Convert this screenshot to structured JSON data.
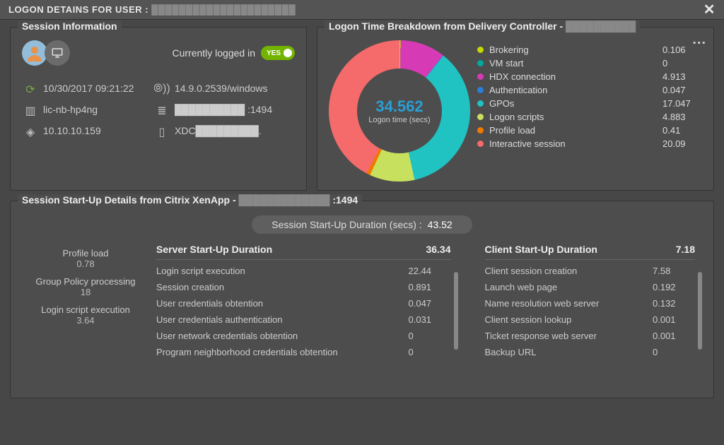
{
  "window": {
    "title_prefix": "LOGON DETAINS FOR USER :",
    "title_user": "█████████████████████"
  },
  "session_info": {
    "title": "Session Information",
    "logged_in_label": "Currently logged in",
    "logged_in_value": "YES",
    "timestamp": "10/30/2017 09:21:22",
    "client_version": "14.9.0.2539/windows",
    "hostname": "lic-nb-hp4ng",
    "server": "██████████ :1494",
    "ip": "10.10.10.159",
    "controller": "XDC█████████."
  },
  "breakdown": {
    "title_prefix": "Logon Time Breakdown from Delivery Controller -",
    "title_suffix": "██████████",
    "center_value": "34.562",
    "center_label": "Logon time (secs)"
  },
  "chart_data": {
    "type": "pie",
    "title": "Logon Time Breakdown from Delivery Controller",
    "unit": "seconds",
    "total": 34.562,
    "series": [
      {
        "name": "Brokering",
        "value": 0.106,
        "color": "#c5d800"
      },
      {
        "name": "VM start",
        "value": 0,
        "color": "#00a99d"
      },
      {
        "name": "HDX connection",
        "value": 4.913,
        "color": "#d63bb5"
      },
      {
        "name": "Authentication",
        "value": 0.047,
        "color": "#2a7fd6"
      },
      {
        "name": "GPOs",
        "value": 17.047,
        "color": "#20c2c2"
      },
      {
        "name": "Logon scripts",
        "value": 4.883,
        "color": "#c7e05e"
      },
      {
        "name": "Profile load",
        "value": 0.41,
        "color": "#f07a00"
      },
      {
        "name": "Interactive session",
        "value": 20.09,
        "color": "#f56a6a"
      }
    ]
  },
  "startup": {
    "title_prefix": "Session Start-Up Details from Citrix XenApp -",
    "title_host": "█████████████",
    "title_port": ":1494",
    "total_label": "Session Start-Up Duration (secs) :",
    "total_value": "43.52",
    "left": [
      {
        "label": "Profile load",
        "value": "0.78"
      },
      {
        "label": "Group Policy processing",
        "value": "18"
      },
      {
        "label": "Login script execution",
        "value": "3.64"
      }
    ],
    "server": {
      "heading": "Server Start-Up Duration",
      "total": "36.34",
      "rows": [
        {
          "label": "Login script execution",
          "value": "22.44"
        },
        {
          "label": "Session creation",
          "value": "0.891"
        },
        {
          "label": "User credentials obtention",
          "value": "0.047"
        },
        {
          "label": "User credentials authentication",
          "value": "0.031"
        },
        {
          "label": "User network credentials obtention",
          "value": "0"
        },
        {
          "label": "Program neighborhood credentials obtention",
          "value": "0"
        }
      ]
    },
    "client": {
      "heading": "Client Start-Up Duration",
      "total": "7.18",
      "rows": [
        {
          "label": "Client session creation",
          "value": "7.58"
        },
        {
          "label": "Launch web page",
          "value": "0.192"
        },
        {
          "label": "Name resolution web server",
          "value": "0.132"
        },
        {
          "label": "Client session lookup",
          "value": "0.001"
        },
        {
          "label": "Ticket response web server",
          "value": "0.001"
        },
        {
          "label": "Backup URL",
          "value": "0"
        }
      ]
    }
  }
}
